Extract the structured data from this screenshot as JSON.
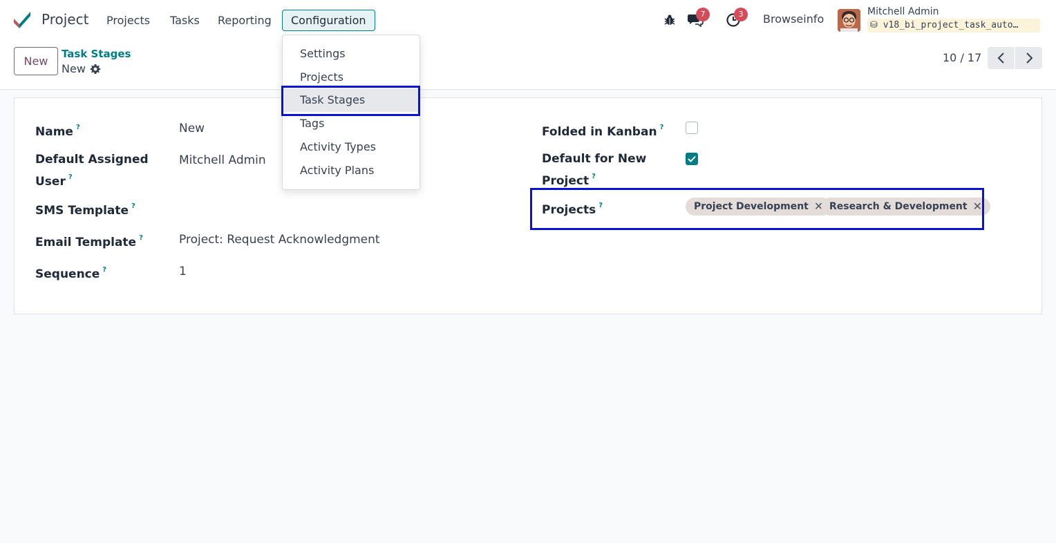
{
  "app": {
    "title": "Project",
    "menu": [
      "Projects",
      "Tasks",
      "Reporting",
      "Configuration"
    ],
    "active_menu": "Configuration"
  },
  "systray": {
    "messages_badge": "7",
    "activities_badge": "3",
    "company": "Browseinfo",
    "user_name": "Mitchell Admin",
    "database": "v18_bi_project_task_auto…"
  },
  "control_panel": {
    "new_label": "New",
    "breadcrumb_parent": "Task Stages",
    "breadcrumb_current": "New",
    "pager": "10 / 17"
  },
  "dropdown": {
    "items": [
      "Settings",
      "Projects",
      "Task Stages",
      "Tags",
      "Activity Types",
      "Activity Plans"
    ],
    "highlighted": "Task Stages"
  },
  "form": {
    "name": {
      "label": "Name",
      "value": "New"
    },
    "default_user": {
      "label_1": "Default Assigned",
      "label_2": "User",
      "value": "Mitchell Admin"
    },
    "sms_template": {
      "label": "SMS Template",
      "value": ""
    },
    "email_template": {
      "label": "Email Template",
      "value": "Project: Request Acknowledgment"
    },
    "sequence": {
      "label": "Sequence",
      "value": "1"
    },
    "folded": {
      "label": "Folded in Kanban",
      "checked": false
    },
    "default_new": {
      "label_1": "Default for New",
      "label_2": "Project",
      "checked": true
    },
    "projects": {
      "label": "Projects",
      "tags": [
        "Project Development",
        "Research & Development"
      ]
    },
    "help_mark": "?"
  },
  "colors": {
    "brand_accent": "#017e84",
    "primary": "#714b67",
    "badge": "#d44c59",
    "highlight_box": "#0a12d4"
  }
}
